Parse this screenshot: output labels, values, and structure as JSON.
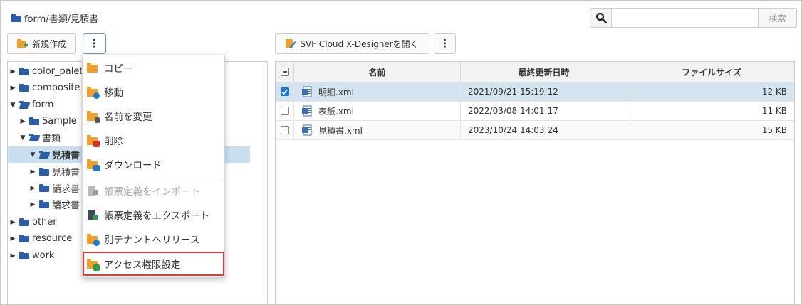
{
  "breadcrumb": "form/書類/見積書",
  "search": {
    "placeholder": "",
    "button_label": "検索"
  },
  "toolbar": {
    "new_label": "新規作成",
    "designer_label": "SVF Cloud X-Designerを開く"
  },
  "tree": {
    "items": [
      {
        "label": "color_palett"
      },
      {
        "label": "composite_"
      },
      {
        "label": "form"
      },
      {
        "label": "Sample"
      },
      {
        "label": "書類"
      },
      {
        "label": "見積書"
      },
      {
        "label": "見積書"
      },
      {
        "label": "請求書"
      },
      {
        "label": "請求書"
      },
      {
        "label": "other"
      },
      {
        "label": "resource"
      },
      {
        "label": "work"
      }
    ]
  },
  "context_menu": {
    "items": [
      {
        "label": "コピー",
        "enabled": true
      },
      {
        "label": "移動",
        "enabled": true
      },
      {
        "label": "名前を変更",
        "enabled": true
      },
      {
        "label": "削除",
        "enabled": true
      },
      {
        "label": "ダウンロード",
        "enabled": true
      },
      {
        "label": "帳票定義をインポート",
        "enabled": false
      },
      {
        "label": "帳票定義をエクスポート",
        "enabled": true
      },
      {
        "label": "別テナントへリリース",
        "enabled": true
      },
      {
        "label": "アクセス権限設定",
        "enabled": true,
        "highlighted": true
      }
    ]
  },
  "table": {
    "headers": [
      "名前",
      "最終更新日時",
      "ファイルサイズ"
    ],
    "rows": [
      {
        "name": "明細.xml",
        "modified": "2021/09/21 15:19:12",
        "size": "12 KB",
        "checked": true
      },
      {
        "name": "表紙.xml",
        "modified": "2022/03/08 14:01:17",
        "size": "11 KB",
        "checked": false
      },
      {
        "name": "見積書.xml",
        "modified": "2023/10/24 14:03:24",
        "size": "15 KB",
        "checked": false
      }
    ]
  },
  "colors": {
    "folder_blue": "#2b5ea7",
    "folder_orange": "#f0a030",
    "selection": "#c9dff0",
    "highlight_border": "#e53935"
  }
}
